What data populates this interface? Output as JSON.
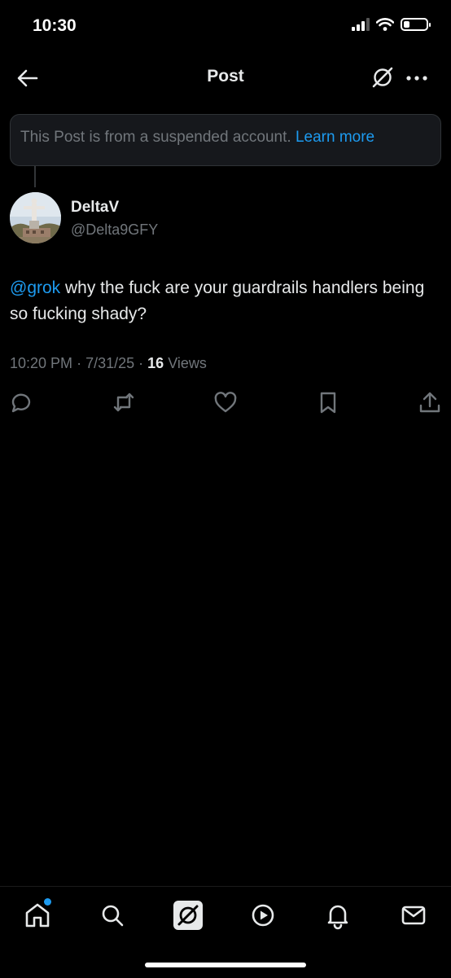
{
  "status_bar": {
    "time": "10:30"
  },
  "header": {
    "title": "Post"
  },
  "notice": {
    "text": "This Post is from a suspended account.",
    "link": "Learn more"
  },
  "post": {
    "author_name": "DeltaV",
    "author_handle": "@Delta9GFY",
    "mention": "@grok",
    "text": " why the fuck are your guardrails handlers being so fucking shady?",
    "time": "10:20 PM",
    "date": "7/31/25",
    "views_count": "16",
    "views_label": "Views"
  },
  "actions": [
    "reply-icon",
    "repost-icon",
    "like-icon",
    "bookmark-icon",
    "share-icon"
  ],
  "tab_bar": [
    "home-icon",
    "search-icon",
    "grok-icon",
    "video-icon",
    "notifications-icon",
    "messages-icon"
  ],
  "colors": {
    "accent": "#1d9bf0",
    "background": "#000000",
    "muted": "#71767b",
    "text": "#e7e9ea"
  }
}
